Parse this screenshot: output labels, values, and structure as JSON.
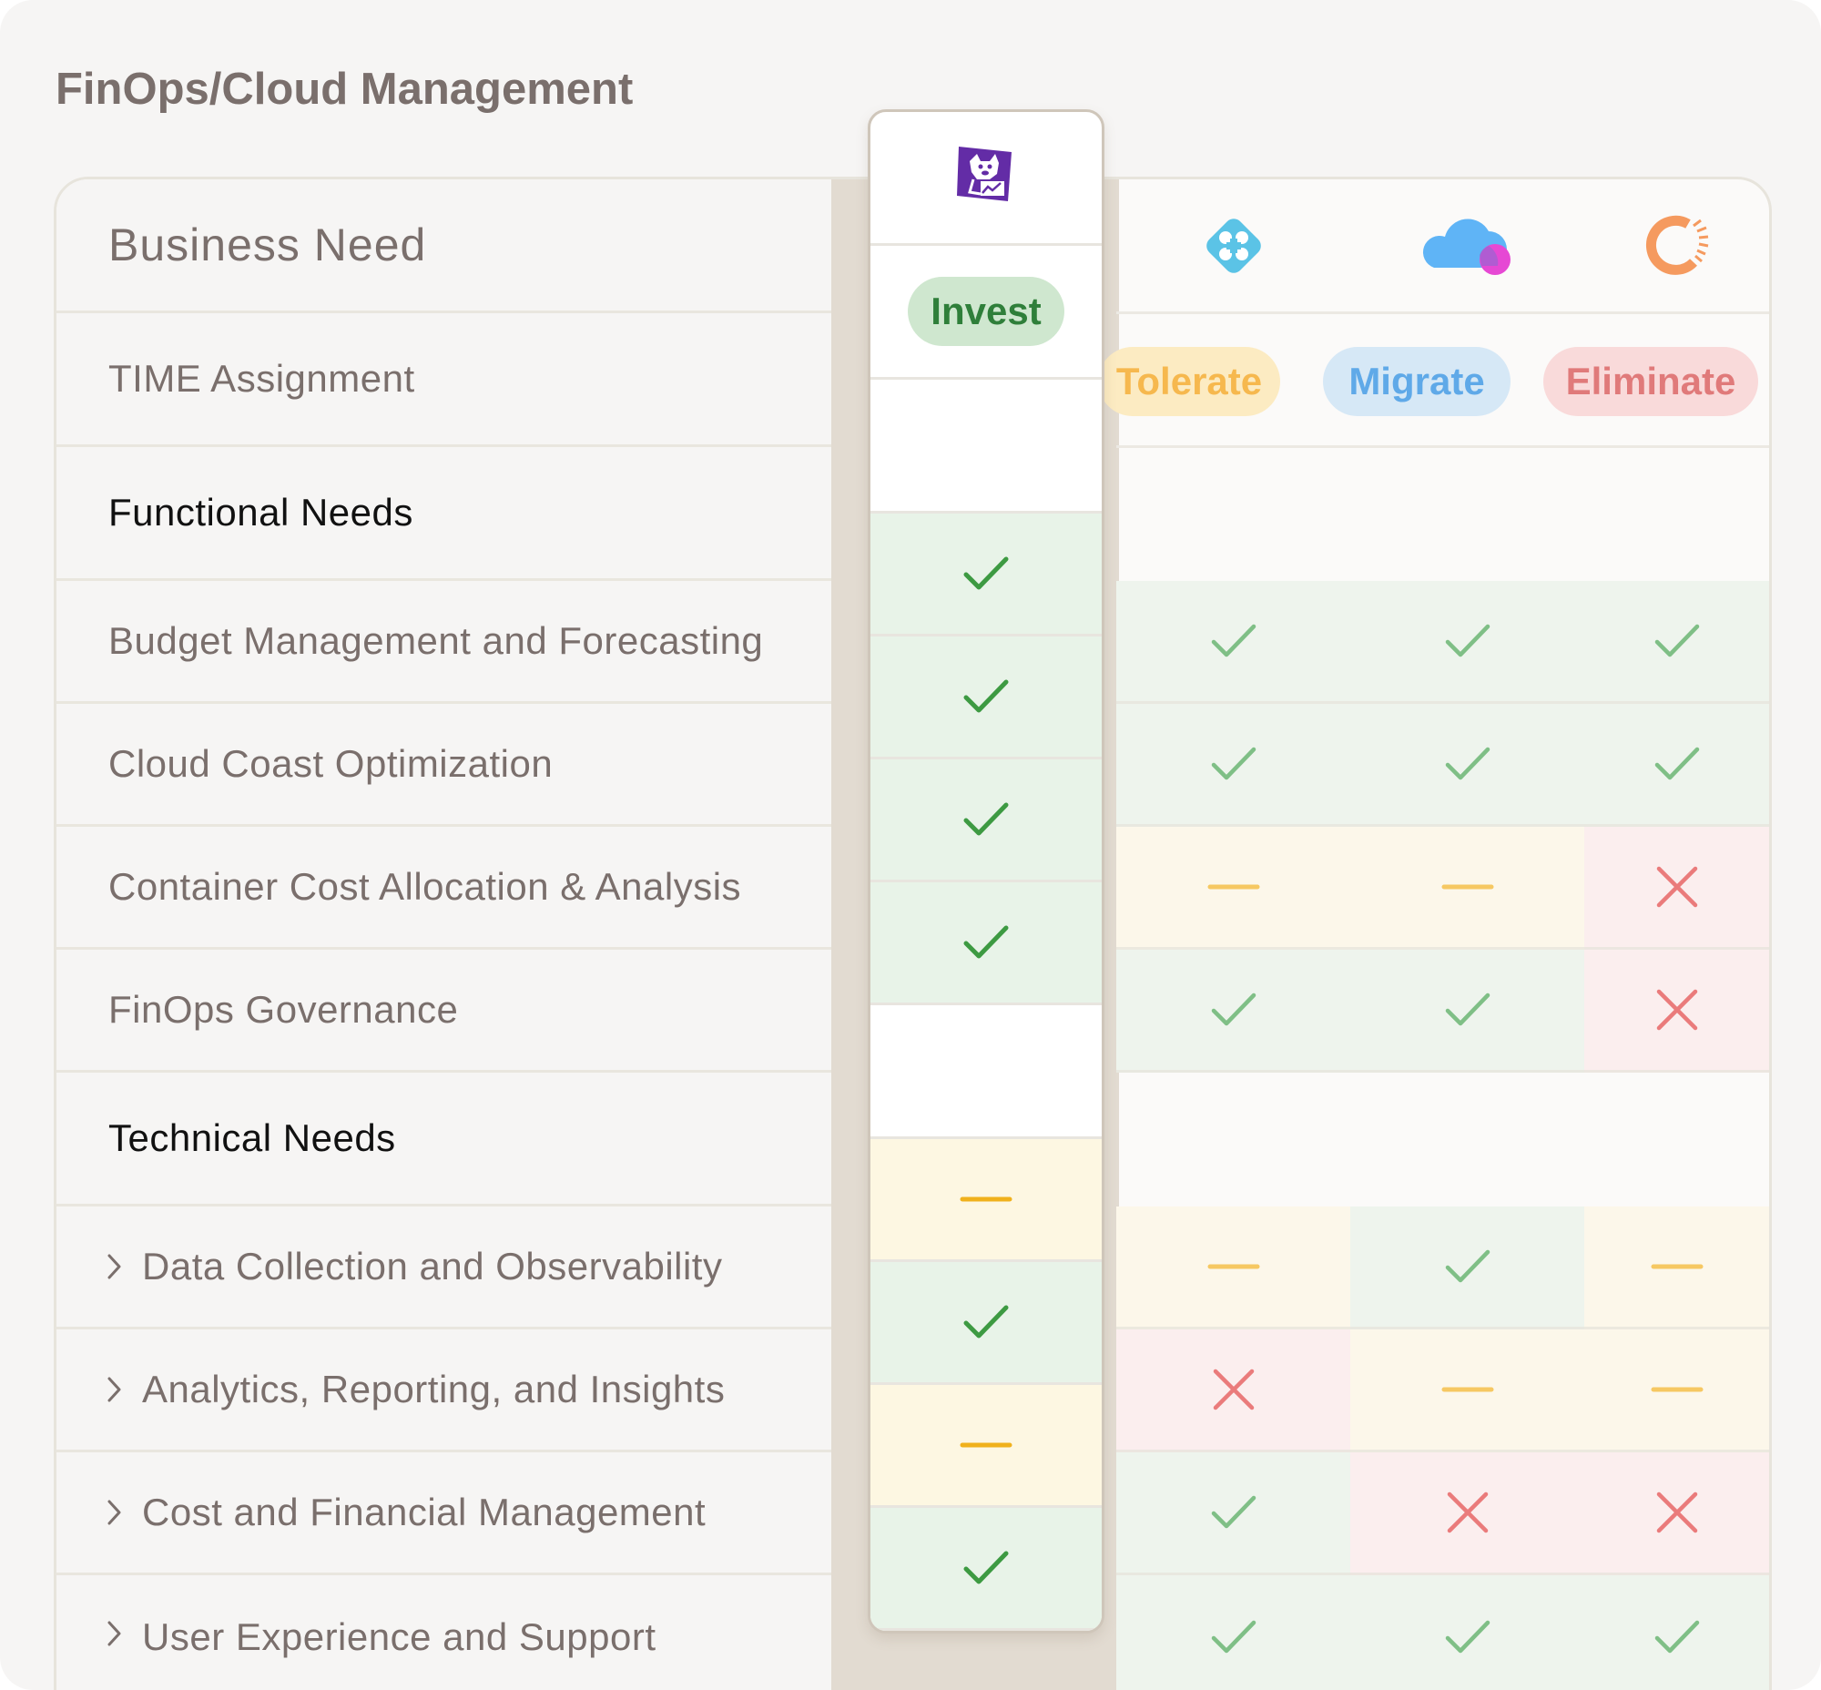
{
  "title": "FinOps/Cloud Management",
  "header_label": "Business Need",
  "time_label": "TIME Assignment",
  "time_tags": {
    "invest": "Invest",
    "tolerate": "Tolerate",
    "migrate": "Migrate",
    "eliminate": "Eliminate"
  },
  "vendors": [
    {
      "icon": "datadog-dog-icon",
      "tag": "Invest",
      "color": "#632ca6"
    },
    {
      "icon": "blue-diamond-logo-icon",
      "tag": "Tolerate",
      "color": "#5bc3e6"
    },
    {
      "icon": "cloud-logo-icon",
      "tag": "Migrate",
      "color": "#5fb4f6"
    },
    {
      "icon": "orange-ring-logo-icon",
      "tag": "Eliminate",
      "color": "#f59a5f"
    }
  ],
  "sections": {
    "functional": "Functional Needs",
    "technical": "Technical Needs"
  },
  "functional_rows": [
    {
      "label": "Budget Management and Forecasting",
      "values": [
        "check",
        "check",
        "check",
        "check"
      ]
    },
    {
      "label": "Cloud Coast Optimization",
      "values": [
        "check",
        "check",
        "check",
        "check"
      ]
    },
    {
      "label": "Container Cost Allocation & Analysis",
      "values": [
        "check",
        "partial",
        "partial",
        "cross"
      ]
    },
    {
      "label": "FinOps Governance",
      "values": [
        "check",
        "check",
        "check",
        "cross"
      ]
    }
  ],
  "technical_rows": [
    {
      "label": "Data Collection and Observability",
      "values": [
        "partial",
        "partial",
        "check",
        "partial"
      ]
    },
    {
      "label": "Analytics, Reporting, and Insights",
      "values": [
        "check",
        "cross",
        "partial",
        "partial"
      ]
    },
    {
      "label": "Cost and Financial Management",
      "values": [
        "partial",
        "check",
        "cross",
        "cross"
      ]
    },
    {
      "label": "User Experience and Support",
      "values": [
        "check",
        "check",
        "check",
        "check"
      ]
    }
  ],
  "colors": {
    "check": "#7fbf86",
    "check_strong": "#3d9a42",
    "partial": "#f6c862",
    "partial_strong": "#f0b11c",
    "cross": "#ea7b7b",
    "invest_pill_bg": "#cfe7cf",
    "invest_pill_fg": "#2f7f3a",
    "tolerate_pill_bg": "#fcebc2",
    "tolerate_pill_fg": "#f6b84e",
    "migrate_pill_bg": "#d6e8f6",
    "migrate_pill_fg": "#5fa9e8",
    "eliminate_pill_bg": "#f9dada",
    "eliminate_pill_fg": "#e07a7a"
  }
}
